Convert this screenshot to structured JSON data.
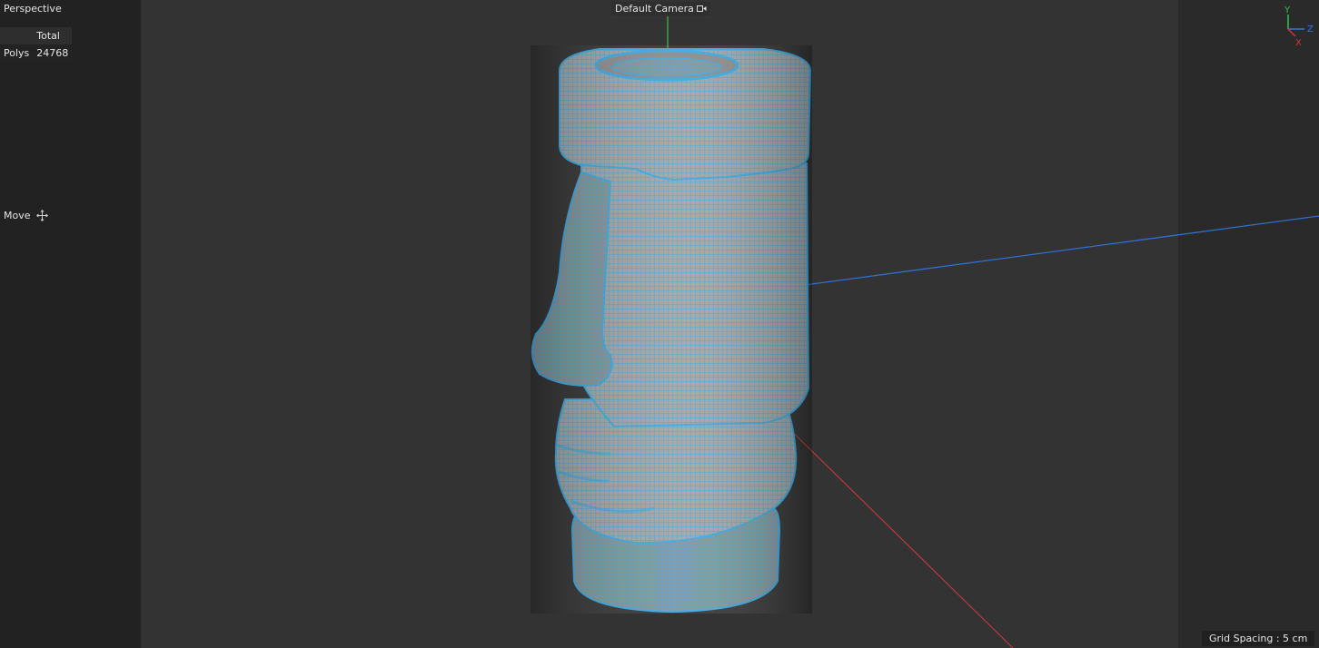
{
  "viewport": {
    "view_name": "Perspective",
    "camera_label": "Default Camera",
    "grid_spacing": "Grid Spacing : 5 cm"
  },
  "stats": {
    "column_header": "Total",
    "rows": [
      {
        "label": "Polys",
        "value": "24768"
      }
    ]
  },
  "tool": {
    "label": "Move",
    "icon": "move-cross-icon"
  },
  "axis_gizmo": {
    "y_label": "Y",
    "z_label": "Z",
    "x_label": "X",
    "colors": {
      "x": "#e03030",
      "y": "#35c04a",
      "z": "#2f78d6"
    }
  },
  "scene": {
    "object": "moai-head",
    "wire_color": "#3aa8e0",
    "surface_color": "#9c9c9c"
  }
}
